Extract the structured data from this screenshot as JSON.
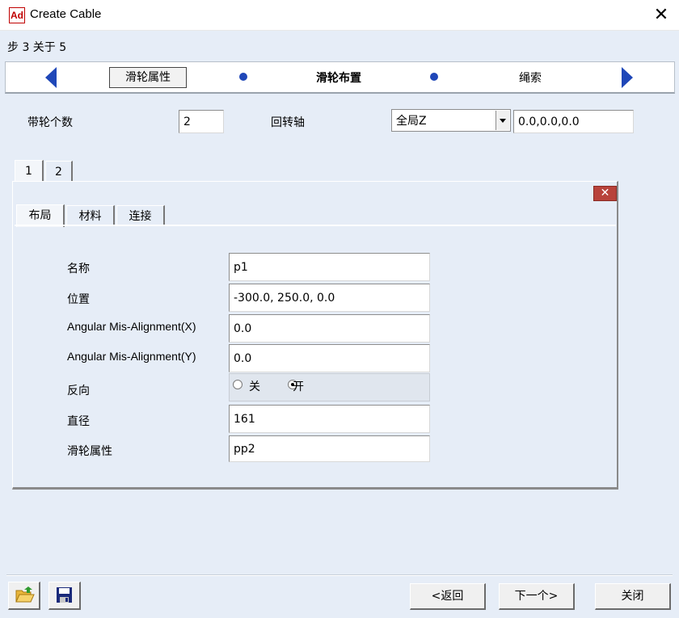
{
  "window": {
    "app_icon_text": "Ad",
    "title": "Create Cable",
    "close_glyph": "✕"
  },
  "step_indicator": "步 3 关于 5",
  "wizard": {
    "steps": [
      {
        "label": "滑轮属性"
      },
      {
        "label": "滑轮布置"
      },
      {
        "label": "绳索"
      }
    ],
    "current_index": 1
  },
  "top_form": {
    "pulley_count_label": "带轮个数",
    "pulley_count_value": "2",
    "rotation_axis_label": "回转轴",
    "rotation_axis_selected": "全局Z",
    "rotation_axis_vector": "0.0,0.0,0.0"
  },
  "pulley_tabs": [
    "1",
    "2"
  ],
  "panel_close_glyph": "✕",
  "sub_tabs": [
    "布局",
    "材料",
    "连接"
  ],
  "layout_form": {
    "name_label": "名称",
    "name_value": "p1",
    "position_label": "位置",
    "position_value": "-300.0, 250.0, 0.0",
    "misalign_x_label": "Angular Mis-Alignment(X)",
    "misalign_x_value": "0.0",
    "misalign_y_label": "Angular Mis-Alignment(Y)",
    "misalign_y_value": "0.0",
    "reverse_label": "反向",
    "reverse_off_label": "关",
    "reverse_on_label": "开",
    "reverse_selected": "开",
    "diameter_label": "直径",
    "diameter_value": "161",
    "pulley_property_label": "滑轮属性",
    "pulley_property_value": "pp2"
  },
  "footer": {
    "back_label": "<返回",
    "next_label": "下一个>",
    "close_label": "关闭"
  },
  "colors": {
    "client_bg": "#e6edf7",
    "accent_blue": "#1f47b8",
    "panel_close_red": "#b8433b"
  }
}
